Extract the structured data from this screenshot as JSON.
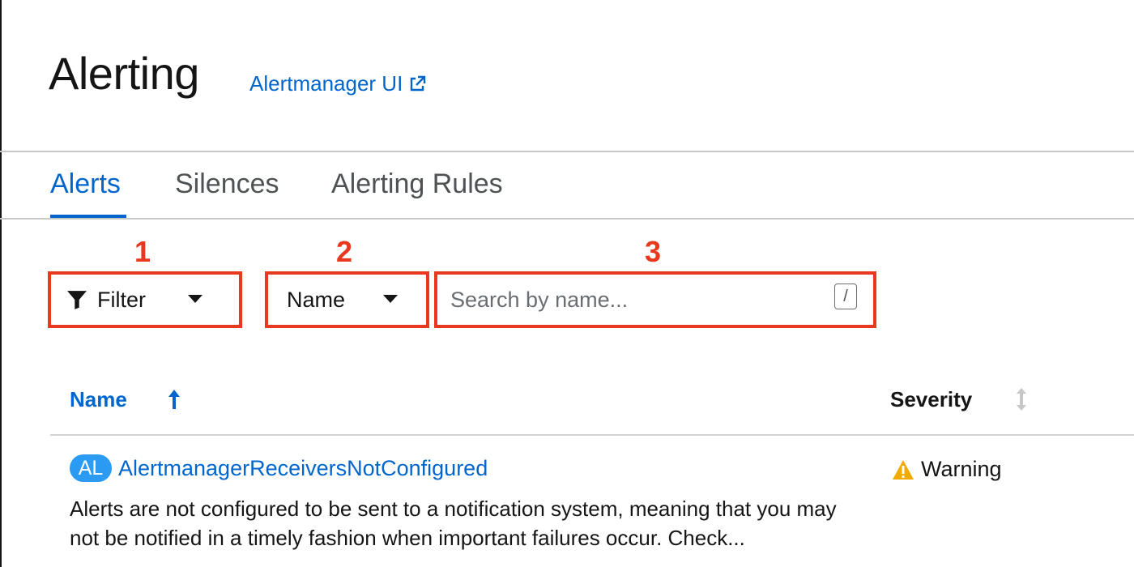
{
  "page": {
    "title": "Alerting",
    "external_link": "Alertmanager UI"
  },
  "tabs": [
    {
      "label": "Alerts",
      "active": true
    },
    {
      "label": "Silences",
      "active": false
    },
    {
      "label": "Alerting Rules",
      "active": false
    }
  ],
  "annotations": [
    "1",
    "2",
    "3"
  ],
  "toolbar": {
    "filter_label": "Filter",
    "attribute_select": "Name",
    "search_placeholder": "Search by name...",
    "search_shortcut": "/"
  },
  "table": {
    "columns": [
      {
        "label": "Name",
        "sort": "ascending"
      },
      {
        "label": "Severity",
        "sort": "none"
      }
    ],
    "rows": [
      {
        "badge": "AL",
        "name": "AlertmanagerReceiversNotConfigured",
        "description": "Alerts are not configured to be sent to a notification system, meaning that you may not be notified in a timely fashion when important failures occur. Check...",
        "severity": "Warning",
        "severity_icon": "warning-triangle-icon"
      }
    ]
  },
  "colors": {
    "link": "#0066cc",
    "annotation": "#e8381e",
    "badge": "#2b9af3",
    "warning": "#f0ab00"
  }
}
